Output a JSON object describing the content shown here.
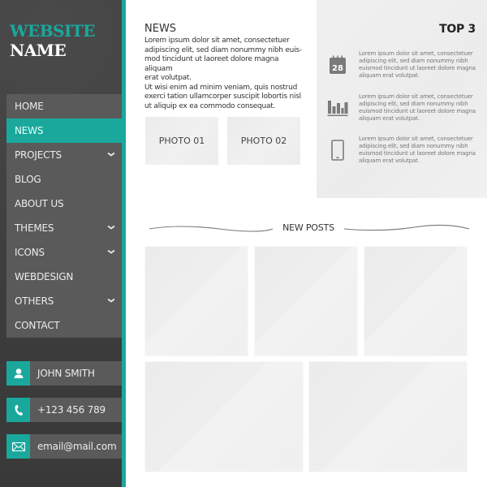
{
  "brand": {
    "line1": "WEBSITE",
    "line2": "NAME",
    "accent_color": "#1aa89d"
  },
  "nav": {
    "items": [
      {
        "label": "HOME",
        "has_submenu": false,
        "active": false
      },
      {
        "label": "NEWS",
        "has_submenu": false,
        "active": true
      },
      {
        "label": "PROJECTS",
        "has_submenu": true,
        "active": false
      },
      {
        "label": "BLOG",
        "has_submenu": false,
        "active": false
      },
      {
        "label": "ABOUT US",
        "has_submenu": false,
        "active": false
      },
      {
        "label": "THEMES",
        "has_submenu": true,
        "active": false
      },
      {
        "label": "ICONS",
        "has_submenu": true,
        "active": false
      },
      {
        "label": "WEBDESIGN",
        "has_submenu": false,
        "active": false
      },
      {
        "label": "OTHERS",
        "has_submenu": true,
        "active": false
      },
      {
        "label": "CONTACT",
        "has_submenu": false,
        "active": false
      }
    ],
    "chevron": "⌄"
  },
  "contact": {
    "name": {
      "icon": "user-icon",
      "text": "JOHN SMITH"
    },
    "phone": {
      "icon": "phone-icon",
      "text": "+123 456 789"
    },
    "email": {
      "icon": "mail-icon",
      "text": "email@mail.com"
    }
  },
  "news": {
    "title": "NEWS",
    "body": "Lorem ipsum dolor sit amet, consectetuer\nadipiscing elit, sed diam nonummy nibh euis-\nmod tincidunt ut laoreet dolore magna aliquam\nerat volutpat.\nUt wisi enim ad minim veniam, quis nostrud\nexerci tation ullamcorper suscipit lobortis nisl\nut aliquip ex ea commodo consequat.",
    "photos": [
      "PHOTO 01",
      "PHOTO 02"
    ]
  },
  "top3": {
    "title": "TOP 3",
    "items": [
      {
        "icon": "calendar-icon",
        "icon_text": "28",
        "text": "Lorem ipsum dolor sit amet, consectetuer adipiscing elit, sed diam nonummy nibh euismod tincidunt ut laoreet dolore magna aliquam erat volutpat."
      },
      {
        "icon": "bar-chart-icon",
        "text": "Lorem ipsum dolor sit amet, consectetuer adipiscing elit, sed diam nonummy nibh euismod tincidunt ut laoreet dolore magna aliquam erat volutpat."
      },
      {
        "icon": "tablet-icon",
        "text": "Lorem ipsum dolor sit amet, consectetuer adipiscing elit, sed diam nonummy nibh euismod tincidunt ut laoreet dolore magna aliquam erat volutpat."
      }
    ]
  },
  "new_posts": {
    "title": "NEW POSTS",
    "count": 5
  }
}
